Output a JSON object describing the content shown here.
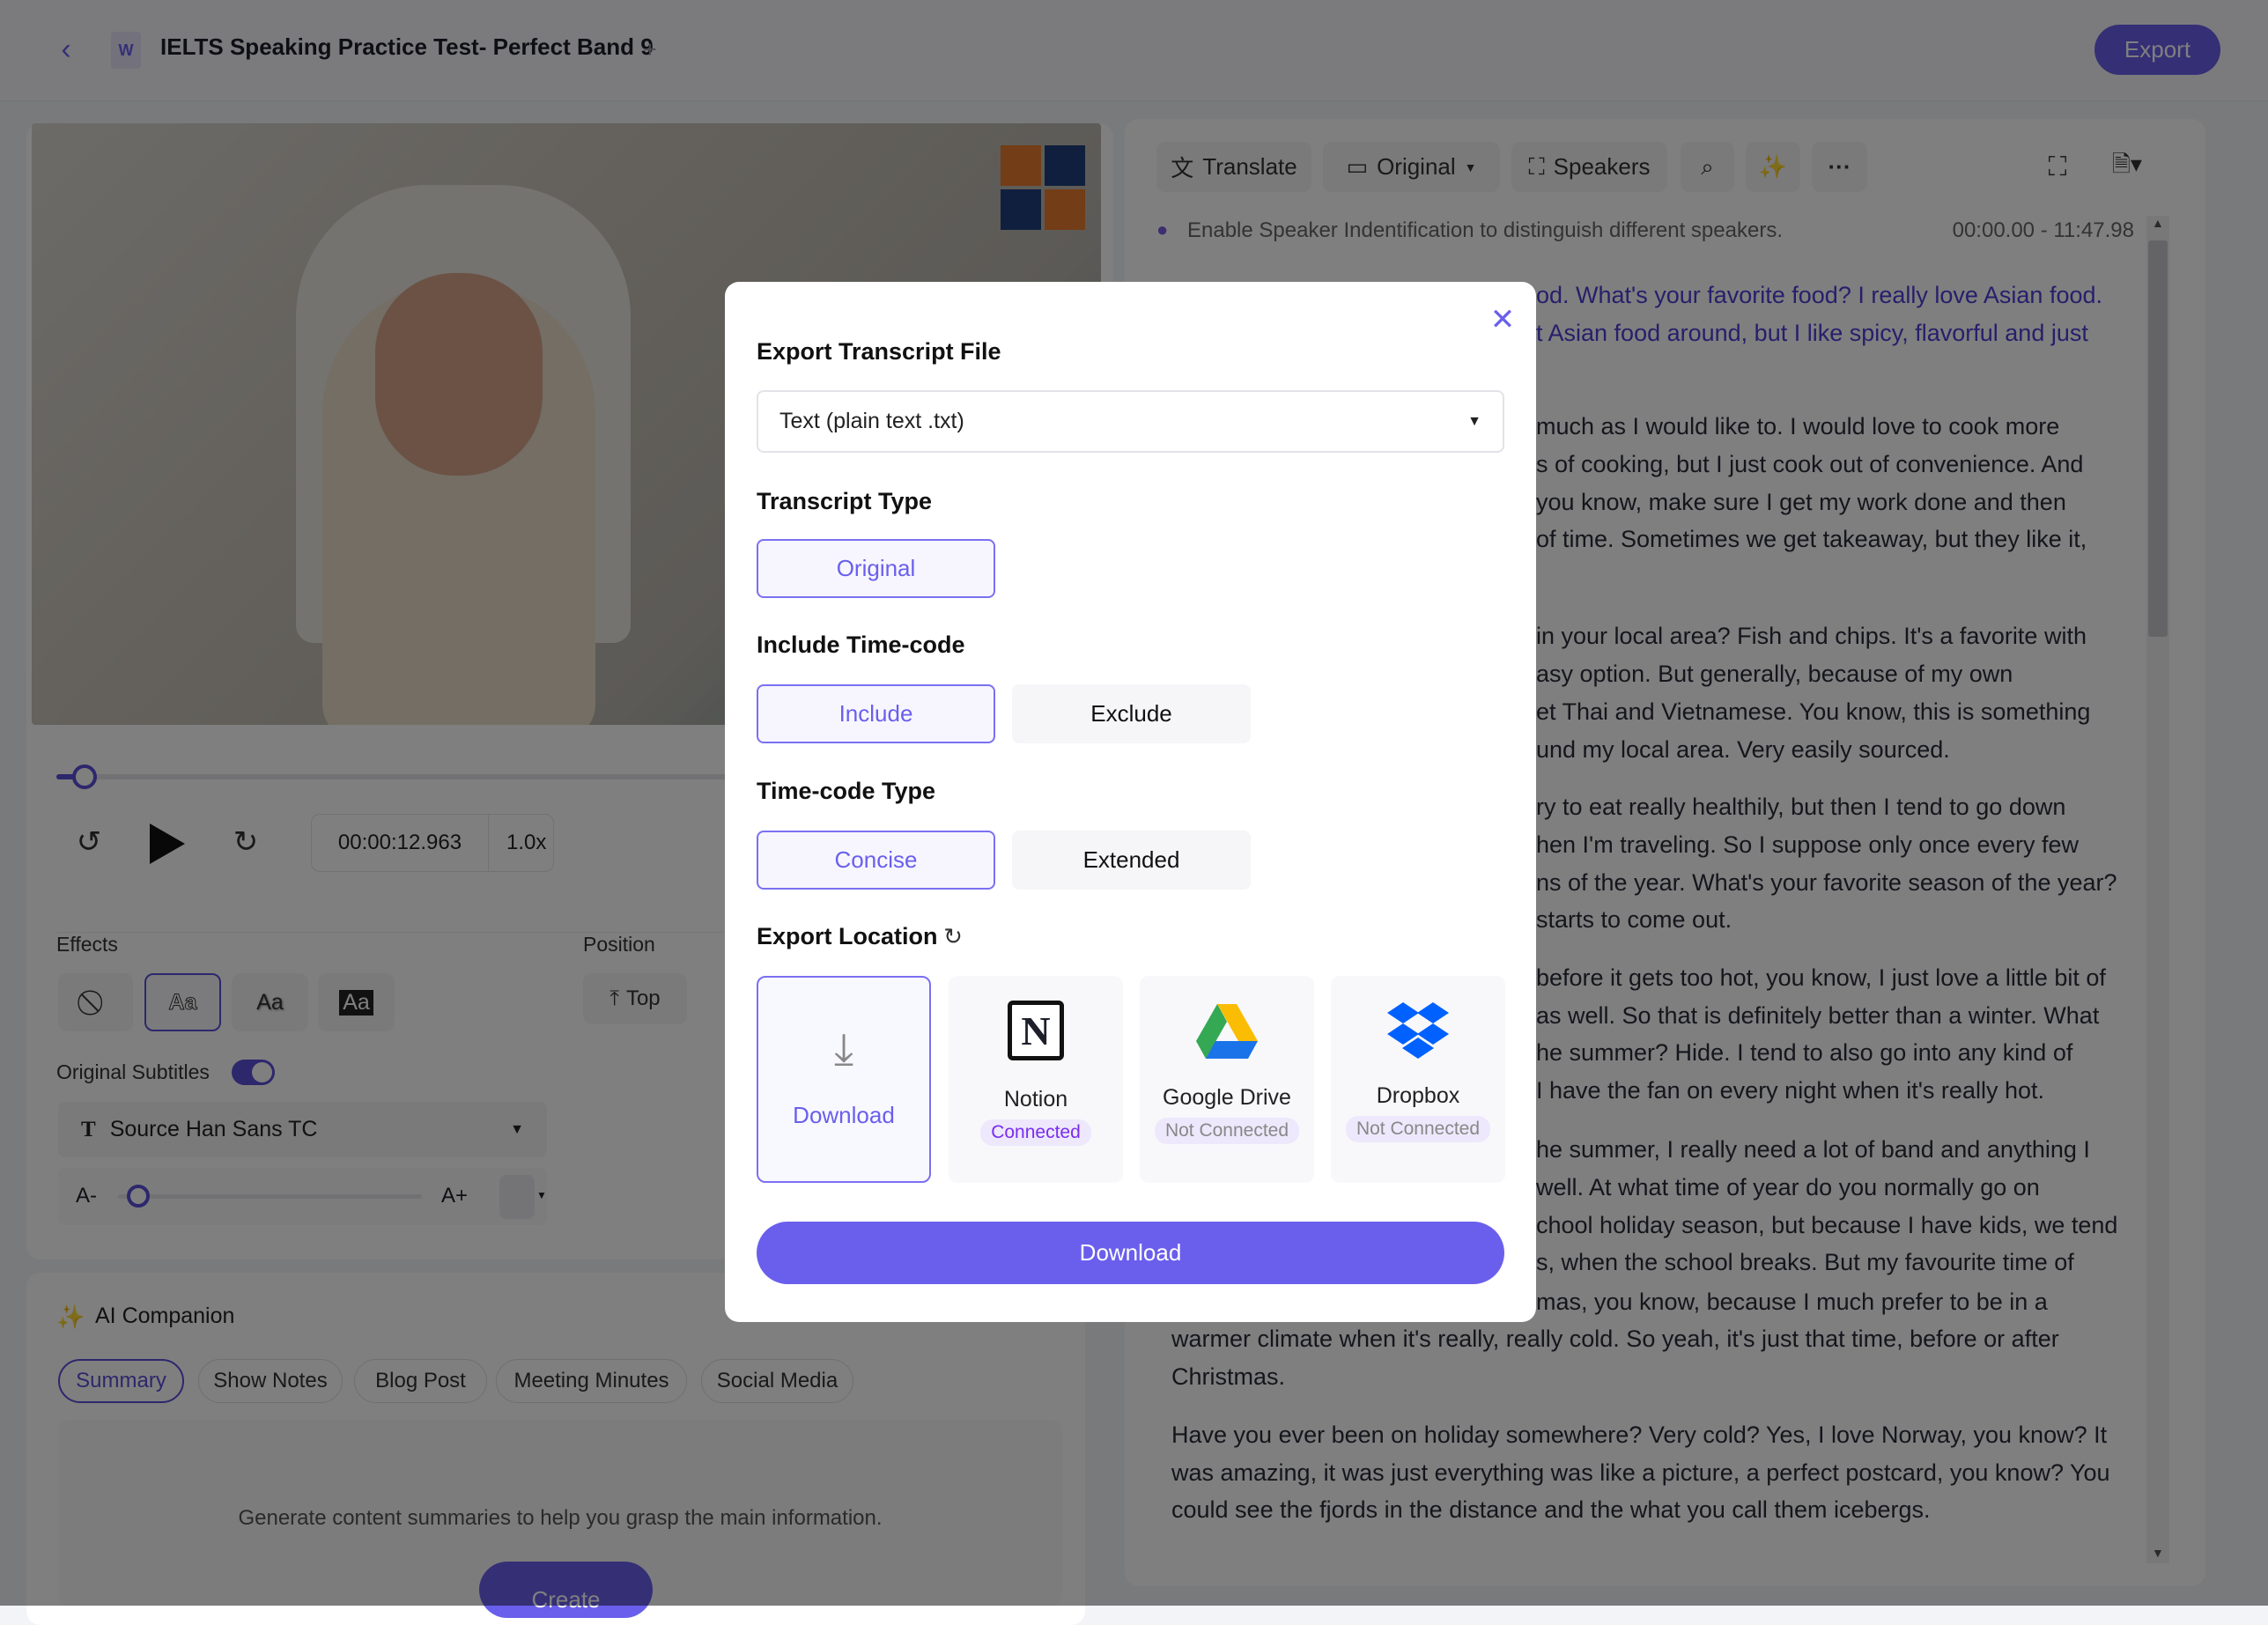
{
  "header": {
    "title": "IELTS Speaking Practice Test- Perfect Band 9",
    "add_tab": "+",
    "export_label": "Export"
  },
  "colors": {
    "accent": "#6a5fec",
    "accent_dark": "#4d3fd6",
    "connected": "#7a2cf0"
  },
  "player": {
    "progress_percent": 2,
    "time": "00:00:12.963",
    "speed": "1.0x"
  },
  "subtitles": {
    "effects_label": "Effects",
    "effects": [
      "none",
      "Aa",
      "Aa",
      "Aa"
    ],
    "selected_effect": 1,
    "position_label": "Position",
    "position_value": "Top",
    "original_subtitles_label": "Original Subtitles",
    "original_subtitles_on": true,
    "font": "Source Han Sans TC",
    "size_minus": "A-",
    "size_plus": "A+",
    "size_percent": 3
  },
  "ai": {
    "title": "AI Companion",
    "tabs": [
      "Summary",
      "Show Notes",
      "Blog Post",
      "Meeting Minutes",
      "Social Media"
    ],
    "active_tab": "Summary",
    "description": "Generate content summaries to help you grasp the main information.",
    "create_label": "Create"
  },
  "transcript": {
    "toolbar": {
      "translate": "Translate",
      "original": "Original",
      "speakers": "Speakers"
    },
    "notice": "Enable Speaker Indentification to distinguish different speakers.",
    "range": "00:00.00 - 11:47.98",
    "lines": [
      "od. What's your favorite food? I really love Asian food.",
      "t Asian food around, but I like spicy, flavorful and just",
      "much as I would like to. I would love to cook more",
      "s of cooking, but I just cook out of convenience. And",
      "you know, make sure I get my work done and then",
      "of time. Sometimes we get takeaway, but they like it,",
      "in your local area? Fish and chips. It's a favorite with",
      "asy option. But generally, because of my own",
      "et Thai and Vietnamese. You know, this is something",
      "und my local area. Very easily sourced.",
      "ry to eat really healthily, but then I tend to go down",
      "hen I'm traveling. So I suppose only once every few",
      "ns of the year. What's your favorite season of the year?",
      "starts to come out.",
      "before it gets too hot, you know, I just love a little bit of",
      "as well. So that is definitely better than a winter. What",
      "he summer? Hide. I tend to also go into any kind of",
      "I have the fan on every night when it's really hot.",
      "he summer, I really need a lot of band and anything I",
      "well. At what time of year do you normally go on",
      "chool holiday season, but because I have kids, we tend",
      "s, when the school breaks. But my favourite time of",
      "mas, you know, because I much prefer to be in a",
      "warmer climate when it's really, really cold. So yeah, it's just that time, before or after",
      "Christmas.",
      "Have you ever been on holiday somewhere? Very cold? Yes, I love Norway, you know? It",
      "was amazing, it was just everything was like a picture, a perfect postcard, you know? You",
      "could see the fjords in the distance and the what you call them icebergs."
    ]
  },
  "modal": {
    "title": "Export Transcript File",
    "format": "Text (plain text .txt)",
    "transcript_type_label": "Transcript Type",
    "transcript_type": "Original",
    "timecode_label": "Include Time-code",
    "timecode_include": "Include",
    "timecode_exclude": "Exclude",
    "timecode_type_label": "Time-code Type",
    "timecode_concise": "Concise",
    "timecode_extended": "Extended",
    "location_label": "Export Location",
    "locations": [
      {
        "name": "Download",
        "status": ""
      },
      {
        "name": "Notion",
        "status": "Connected"
      },
      {
        "name": "Google Drive",
        "status": "Not Connected"
      },
      {
        "name": "Dropbox",
        "status": "Not Connected"
      }
    ],
    "download_label": "Download"
  }
}
